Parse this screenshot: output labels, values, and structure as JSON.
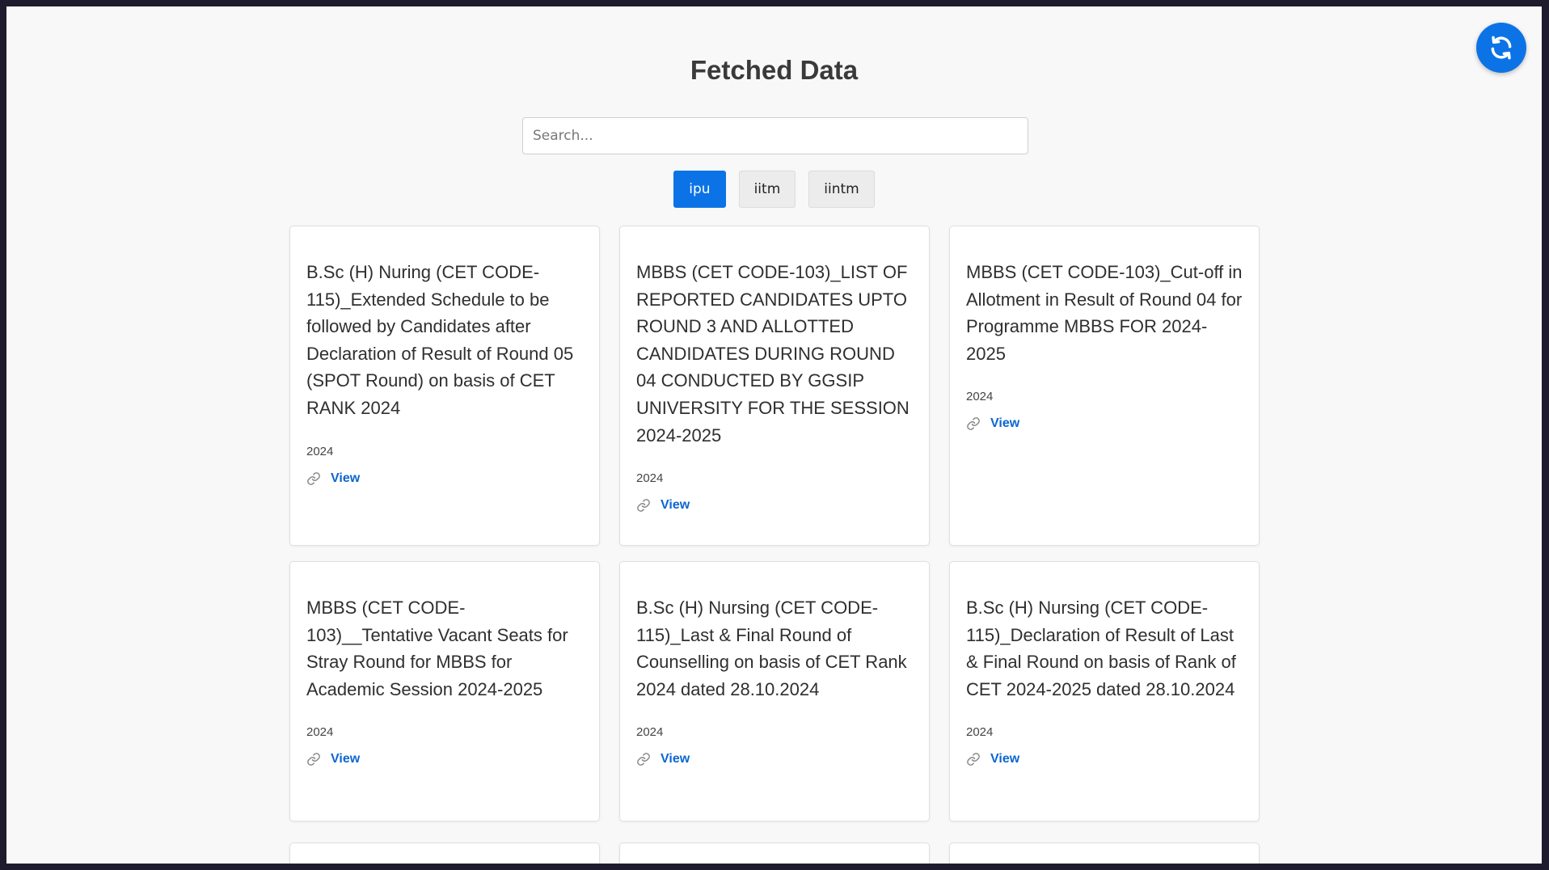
{
  "header": {
    "title": "Fetched Data"
  },
  "search": {
    "placeholder": "Search..."
  },
  "tabs": [
    {
      "label": "ipu",
      "active": true
    },
    {
      "label": "iitm",
      "active": false
    },
    {
      "label": "iintm",
      "active": false
    }
  ],
  "cards": [
    {
      "title": "B.Sc (H) Nuring (CET CODE-115)_Extended Schedule to be followed by Candidates after Declaration of Result of Round 05 (SPOT Round) on basis of CET RANK 2024",
      "year": "2024",
      "link_label": "View"
    },
    {
      "title": "MBBS (CET CODE-103)_LIST OF REPORTED CANDIDATES UPTO ROUND 3 AND ALLOTTED CANDIDATES DURING ROUND 04 CONDUCTED BY GGSIP UNIVERSITY FOR THE SESSION 2024-2025",
      "year": "2024",
      "link_label": "View"
    },
    {
      "title": "MBBS (CET CODE-103)_Cut-off in Allotment in Result of Round 04 for Programme MBBS FOR 2024-2025",
      "year": "2024",
      "link_label": "View"
    },
    {
      "title": "MBBS (CET CODE-103)__Tentative Vacant Seats for Stray Round for MBBS for Academic Session 2024-2025",
      "year": "2024",
      "link_label": "View"
    },
    {
      "title": "B.Sc (H) Nursing (CET CODE-115)_Last & Final Round of Counselling on basis of CET Rank 2024 dated 28.10.2024",
      "year": "2024",
      "link_label": "View"
    },
    {
      "title": "B.Sc (H) Nursing (CET CODE-115)_Declaration of Result of Last & Final Round on basis of Rank of CET 2024-2025 dated 28.10.2024",
      "year": "2024",
      "link_label": "View"
    }
  ],
  "colors": {
    "accent": "#0b73e6",
    "link": "#0b66d0"
  },
  "icons": {
    "refresh": "refresh-icon",
    "link": "link-icon"
  }
}
